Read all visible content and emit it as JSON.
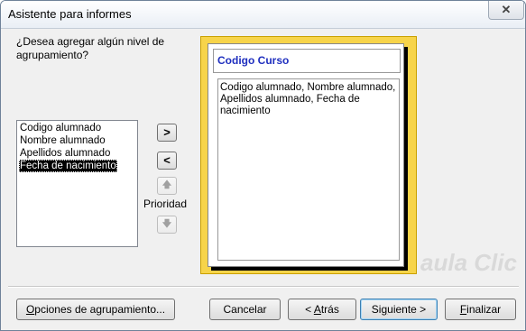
{
  "window": {
    "title": "Asistente para informes",
    "close_symbol": "✕"
  },
  "prompt": {
    "question": "¿Desea agregar algún nivel de agrupamiento?"
  },
  "fields_list": {
    "items": [
      "Codigo alumnado",
      "Nombre alumnado",
      "Apellidos alumnado",
      "Fecha de nacimiento"
    ],
    "selected_index": 3
  },
  "arrows": {
    "add": ">",
    "remove": "<",
    "up": "🡅",
    "down": "🡇"
  },
  "priority_label": "Prioridad",
  "preview": {
    "group_header": "Codigo Curso",
    "detail_fields": "Codigo alumnado, Nombre alumnado, Apellidos alumnado, Fecha de nacimiento"
  },
  "buttons": {
    "grouping_options": {
      "u": "O",
      "rest": "pciones de agrupamiento..."
    },
    "cancel": "Cancelar",
    "back": {
      "pre": "< ",
      "u": "A",
      "rest": "trás"
    },
    "next": {
      "pre": "Si",
      "u": "g",
      "rest": "uiente >"
    },
    "finish": {
      "u": "F",
      "rest": "inalizar"
    }
  },
  "watermark": "aula Clic",
  "colors": {
    "preview_frame": "#f7d44a",
    "group_header_text": "#1f2fbf",
    "selection": "#000000"
  }
}
